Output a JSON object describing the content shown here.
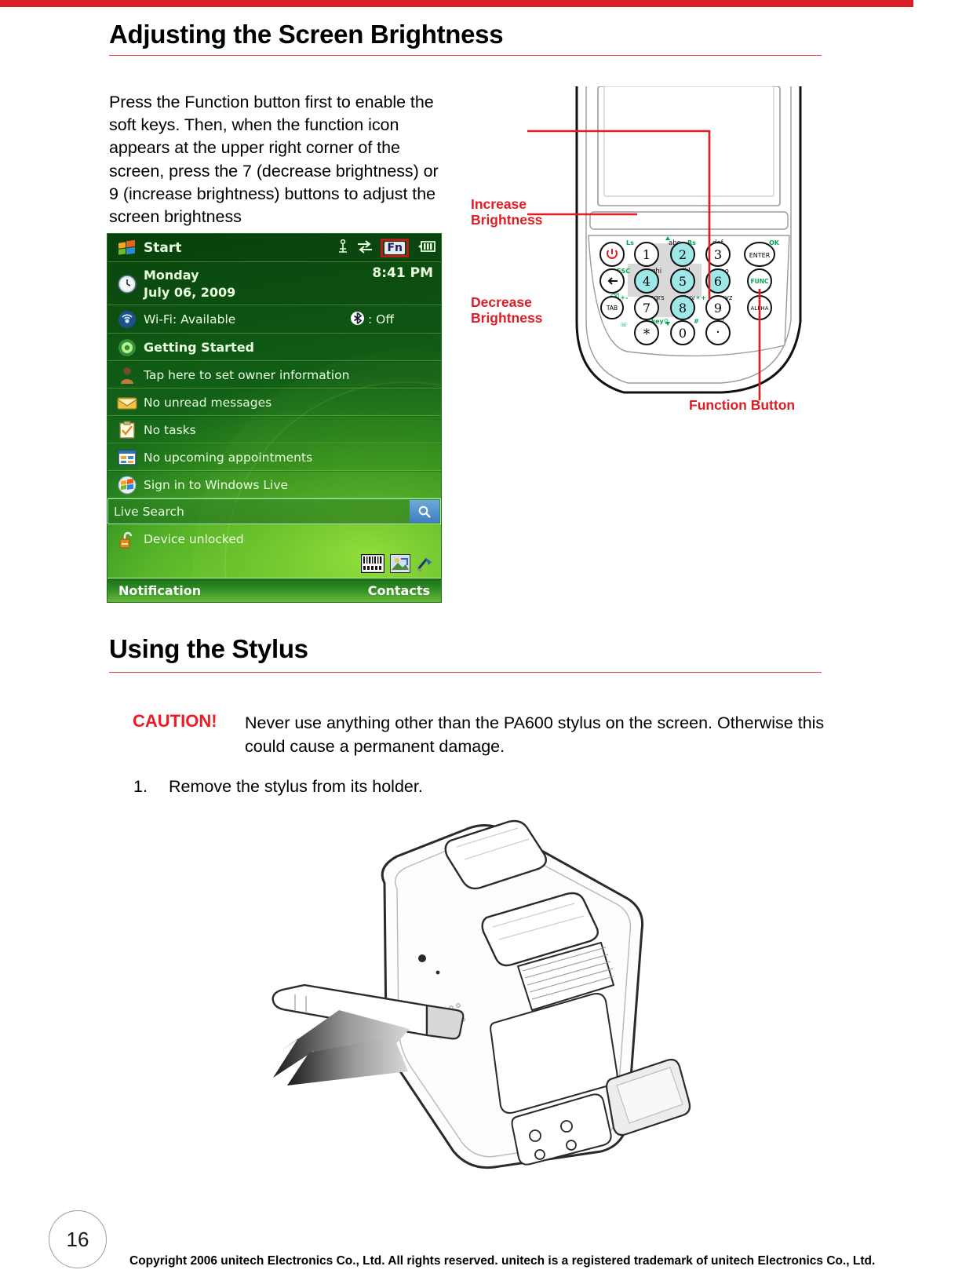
{
  "page": {
    "number": "16",
    "copyright": "Copyright 2006 unitech Electronics Co., Ltd. All rights reserved. unitech is a registered trademark of unitech Electronics Co., Ltd."
  },
  "sections": {
    "brightness": {
      "heading": "Adjusting the Screen Brightness",
      "paragraph": "Press the Function button first to enable the soft keys. Then, when the function icon appears at the upper right corner of the screen, press the 7 (decrease brightness) or 9 (increase brightness) buttons to adjust the screen brightness"
    },
    "stylus": {
      "heading": "Using the Stylus",
      "caution_label": "CAUTION!",
      "caution_text": "Never use anything other than the PA600 stylus on the screen. Otherwise this could cause a permanent damage.",
      "steps": [
        {
          "num": "1.",
          "text": "Remove the stylus from its holder."
        }
      ]
    }
  },
  "pda_screenshot": {
    "statusbar": {
      "start_label": "Start",
      "icons": [
        "signal-icon",
        "connectivity-icon",
        "fn-icon",
        "battery-icon"
      ],
      "fn_label": "Fn"
    },
    "rows": [
      {
        "icon": "windows-flag-icon",
        "label": "Start"
      },
      {
        "icon": "clock-icon",
        "label": "Monday",
        "label2": "July 06, 2009",
        "right": "8:41 PM"
      },
      {
        "icon": "wifi-icon",
        "label": "Wi-Fi: Available",
        "right": ": Off",
        "right_icon": "bluetooth-icon"
      },
      {
        "icon": "getting-started-icon",
        "label": "Getting Started"
      },
      {
        "icon": "owner-icon",
        "label": "Tap here to set owner information"
      },
      {
        "icon": "mail-icon",
        "label": "No unread messages"
      },
      {
        "icon": "tasks-icon",
        "label": "No tasks"
      },
      {
        "icon": "calendar-icon",
        "label": "No upcoming appointments"
      },
      {
        "icon": "windows-live-icon",
        "label": "Sign in to Windows Live"
      },
      {
        "icon": "search-icon",
        "label": "Live Search"
      },
      {
        "icon": "unlock-icon",
        "label": "Device unlocked"
      }
    ],
    "tray_icons": [
      "barcode-icon",
      "picture-icon",
      "antenna-icon"
    ],
    "softkeys": {
      "left": "Notification",
      "right": "Contacts"
    }
  },
  "device_figure": {
    "callouts": [
      {
        "name": "increase-brightness",
        "text": "Increase\nBrightness"
      },
      {
        "name": "decrease-brightness",
        "text": "Decrease\nBrightness"
      },
      {
        "name": "function-button",
        "text": "Function Button"
      }
    ],
    "keypad": {
      "keys": [
        {
          "label": "1",
          "alt": "Ls"
        },
        {
          "label": "2",
          "alt": "abc"
        },
        {
          "label": "3",
          "alt": "def"
        },
        {
          "label": "4",
          "alt": "ghi"
        },
        {
          "label": "5",
          "alt": "jkl"
        },
        {
          "label": "6",
          "alt": "mno"
        },
        {
          "label": "7",
          "alt": "pqrs"
        },
        {
          "label": "8",
          "alt": "tuv"
        },
        {
          "label": "9",
          "alt": "wxyz"
        },
        {
          "label": "*",
          "alt": "key"
        },
        {
          "label": "0",
          "alt": ""
        },
        {
          "label": ".",
          "alt": "/"
        }
      ],
      "function_keys": [
        "ENTER",
        "FUNC",
        "ALPHA",
        "TAB",
        "ESC"
      ],
      "markers": [
        "Ls",
        "Rs",
        "OK",
        "ESC",
        "#"
      ],
      "power_icon": "power-icon",
      "back_icon": "back-arrow-icon"
    }
  },
  "colors": {
    "accent_red": "#d82028",
    "caution_red": "#ed1c24",
    "rule_red": "#d63b3b"
  }
}
